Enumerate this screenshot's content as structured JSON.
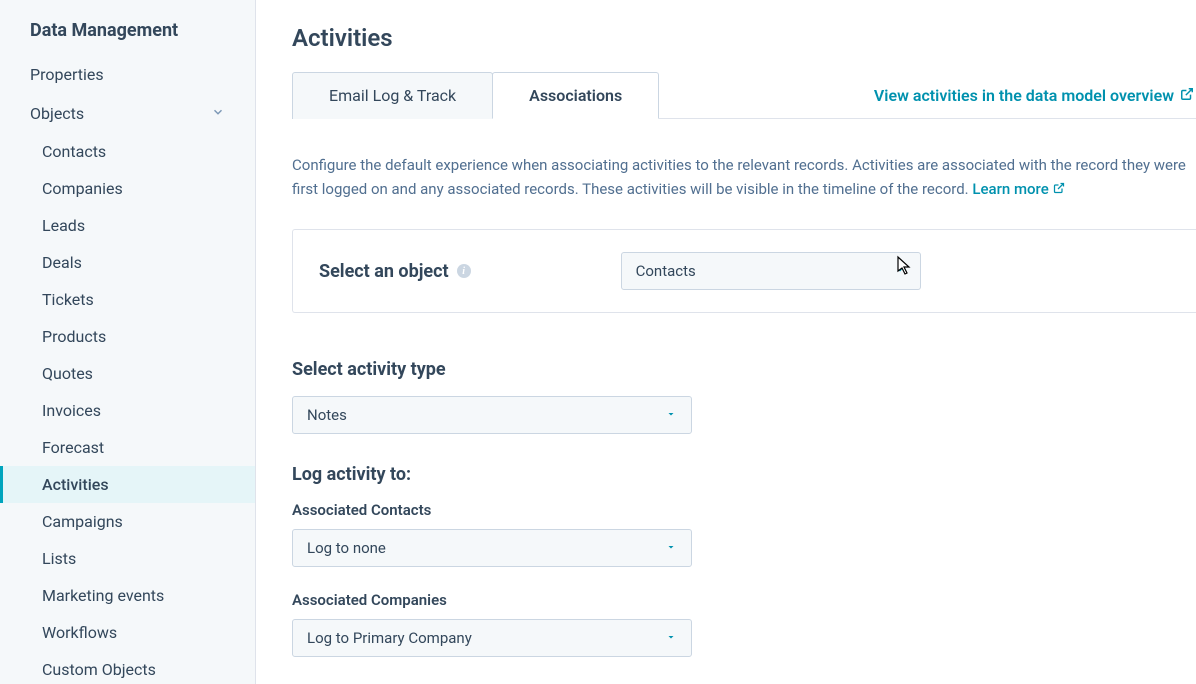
{
  "sidebar": {
    "heading": "Data Management",
    "top_items": [
      {
        "label": "Properties"
      },
      {
        "label": "Objects",
        "expandable": true
      }
    ],
    "objects_sub": [
      {
        "label": "Contacts"
      },
      {
        "label": "Companies"
      },
      {
        "label": "Leads"
      },
      {
        "label": "Deals"
      },
      {
        "label": "Tickets"
      },
      {
        "label": "Products"
      },
      {
        "label": "Quotes"
      },
      {
        "label": "Invoices"
      },
      {
        "label": "Forecast"
      },
      {
        "label": "Activities",
        "active": true
      },
      {
        "label": "Campaigns"
      },
      {
        "label": "Lists"
      },
      {
        "label": "Marketing events"
      },
      {
        "label": "Workflows"
      },
      {
        "label": "Custom Objects"
      }
    ]
  },
  "main": {
    "title": "Activities",
    "tabs": [
      {
        "label": "Email Log & Track"
      },
      {
        "label": "Associations",
        "active": true
      }
    ],
    "view_link": "View activities in the data model overview",
    "description": "Configure the default experience when associating activities to the relevant records. Activities are associated with the record they were first logged on and any associated records. These activities will be visible in the timeline of the record.",
    "learn_more": "Learn more",
    "select_object": {
      "label": "Select an object",
      "value": "Contacts"
    },
    "activity_type": {
      "label": "Select activity type",
      "value": "Notes"
    },
    "log_heading": "Log activity to:",
    "log_fields": [
      {
        "label": "Associated Contacts",
        "value": "Log to none"
      },
      {
        "label": "Associated Companies",
        "value": "Log to Primary Company"
      }
    ]
  }
}
